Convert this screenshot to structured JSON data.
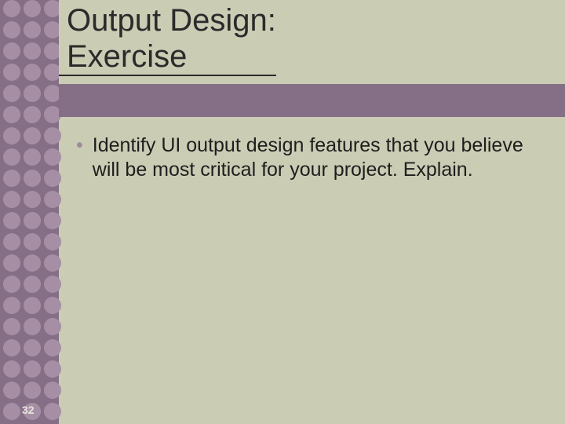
{
  "slide": {
    "title_line1": "Output Design:",
    "title_line2": "Exercise",
    "bullets": [
      "Identify UI output design features that you believe will be most critical for your project. Explain."
    ],
    "page_number": "32"
  }
}
